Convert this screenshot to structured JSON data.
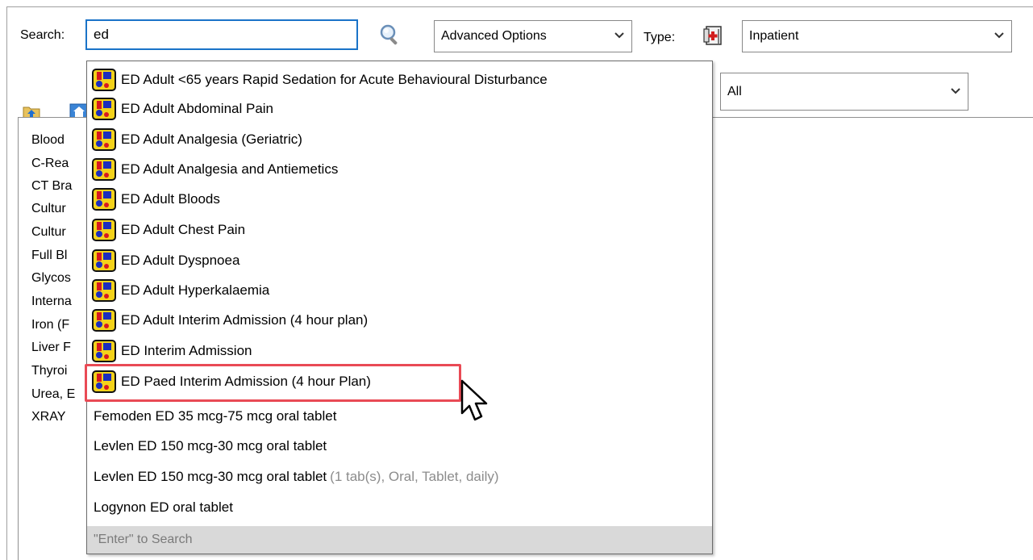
{
  "search": {
    "label": "Search:",
    "value": "ed",
    "icon": "magnifier-icon"
  },
  "advanced_options": {
    "value": "Advanced Options"
  },
  "type": {
    "label": "Type:",
    "icon": "medical-record-icon",
    "value": "Inpatient"
  },
  "filter": {
    "value": "All"
  },
  "toolbar": {
    "icons": [
      "folder-up-icon",
      "home-icon"
    ]
  },
  "favorites_list": [
    "Blood",
    "C-Rea",
    "CT Bra",
    "Cultur",
    "Cultur",
    "Full Bl",
    "Glycos",
    "Interna",
    "Iron (F",
    "Liver F",
    "Thyroi",
    "Urea, E",
    "XRAY"
  ],
  "dropdown": {
    "items": [
      {
        "label": "ED Adult <65 years Rapid Sedation for Acute Behavioural Disturbance",
        "icon": "powerplan-icon"
      },
      {
        "label": "ED Adult Abdominal Pain",
        "icon": "powerplan-icon"
      },
      {
        "label": "ED Adult Analgesia (Geriatric)",
        "icon": "powerplan-icon"
      },
      {
        "label": "ED Adult Analgesia and Antiemetics",
        "icon": "powerplan-icon"
      },
      {
        "label": "ED Adult Bloods",
        "icon": "powerplan-icon"
      },
      {
        "label": "ED Adult Chest Pain",
        "icon": "powerplan-icon"
      },
      {
        "label": "ED Adult Dyspnoea",
        "icon": "powerplan-icon"
      },
      {
        "label": "ED Adult Hyperkalaemia",
        "icon": "powerplan-icon"
      },
      {
        "label": "ED Adult Interim Admission (4 hour plan)",
        "icon": "powerplan-icon"
      },
      {
        "label": "ED Interim Admission",
        "icon": "powerplan-icon"
      },
      {
        "label": "ED Paed Interim Admission (4 hour Plan)",
        "icon": "powerplan-icon"
      },
      {
        "label": "Femoden ED 35 mcg-75 mcg oral tablet"
      },
      {
        "label": "Levlen ED 150 mcg-30 mcg oral tablet"
      },
      {
        "label": "Levlen ED 150 mcg-30 mcg oral tablet",
        "extra": "(1 tab(s), Oral, Tablet, daily)"
      },
      {
        "label": "Logynon ED oral tablet"
      }
    ],
    "footer": "\"Enter\" to Search"
  },
  "colors": {
    "highlight_border": "#e94a55",
    "search_focus": "#1a73c8",
    "footer_bg": "#d9d9d9"
  }
}
